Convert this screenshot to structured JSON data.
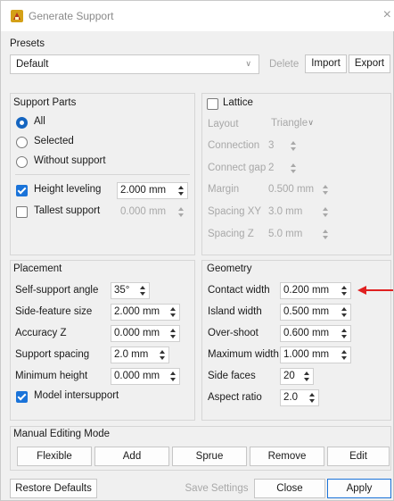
{
  "title": "Generate Support",
  "close_glyph": "×",
  "presets": {
    "group_label": "Presets",
    "selected": "Default",
    "delete_label": "Delete",
    "import_label": "Import",
    "export_label": "Export"
  },
  "support_parts": {
    "group_label": "Support Parts",
    "options": [
      "All",
      "Selected",
      "Without support"
    ],
    "height_leveling_label": "Height leveling",
    "height_leveling_value": "2.000 mm",
    "height_leveling_checked": true,
    "tallest_support_label": "Tallest support",
    "tallest_support_value": "0.000 mm",
    "tallest_support_checked": false
  },
  "lattice": {
    "label": "Lattice",
    "checked": false,
    "layout_label": "Layout",
    "layout_value": "Triangle",
    "connection_label": "Connection",
    "connection_value": "3",
    "connect_gap_label": "Connect gap",
    "connect_gap_value": "2",
    "margin_label": "Margin",
    "margin_value": "0.500 mm",
    "spacing_xy_label": "Spacing XY",
    "spacing_xy_value": "3.0 mm",
    "spacing_z_label": "Spacing Z",
    "spacing_z_value": "5.0 mm"
  },
  "placement": {
    "group_label": "Placement",
    "self_support_angle_label": "Self-support angle",
    "self_support_angle_value": "35°",
    "side_feature_size_label": "Side-feature size",
    "side_feature_size_value": "2.000 mm",
    "accuracy_z_label": "Accuracy Z",
    "accuracy_z_value": "0.000 mm",
    "support_spacing_label": "Support spacing",
    "support_spacing_value": "2.0 mm",
    "minimum_height_label": "Minimum height",
    "minimum_height_value": "0.000 mm",
    "model_intersupport_label": "Model intersupport",
    "model_intersupport_checked": true
  },
  "geometry": {
    "group_label": "Geometry",
    "contact_width_label": "Contact width",
    "contact_width_value": "0.200 mm",
    "island_width_label": "Island width",
    "island_width_value": "0.500 mm",
    "over_shoot_label": "Over-shoot",
    "over_shoot_value": "0.600 mm",
    "maximum_width_label": "Maximum width",
    "maximum_width_value": "1.000 mm",
    "side_faces_label": "Side faces",
    "side_faces_value": "20",
    "aspect_ratio_label": "Aspect ratio",
    "aspect_ratio_value": "2.0"
  },
  "manual_editing": {
    "group_label": "Manual Editing Mode",
    "buttons": [
      "Flexible",
      "Add",
      "Sprue",
      "Remove",
      "Edit"
    ]
  },
  "footer": {
    "restore_defaults_label": "Restore Defaults",
    "save_settings_label": "Save Settings",
    "close_label": "Close",
    "apply_label": "Apply"
  },
  "colors": {
    "accent": "#1a73d9",
    "annotation_arrow": "#e02020"
  }
}
